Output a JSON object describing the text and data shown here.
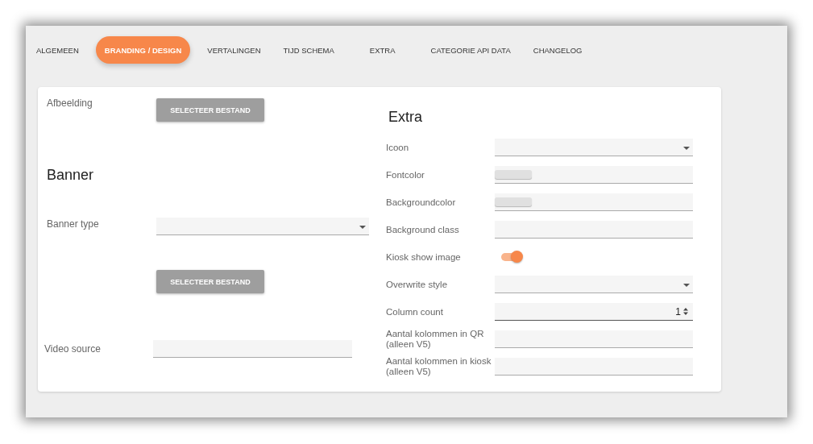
{
  "tabs": [
    {
      "label": "ALGEMEEN",
      "selected": false
    },
    {
      "label": "BRANDING / DESIGN",
      "selected": true
    },
    {
      "label": "VERTALINGEN",
      "selected": false
    },
    {
      "label": "TIJD SCHEMA",
      "selected": false
    },
    {
      "label": "EXTRA",
      "selected": false
    },
    {
      "label": "CATEGORIE API DATA",
      "selected": false
    },
    {
      "label": "CHANGELOG",
      "selected": false
    }
  ],
  "left": {
    "image_label": "Afbeelding",
    "image_button": "SELECTEER BESTAND",
    "banner_heading": "Banner",
    "banner_type_label": "Banner type",
    "banner_button": "SELECTEER BESTAND",
    "video_label": "Video source"
  },
  "extra": {
    "heading": "Extra",
    "fields": [
      {
        "label": "Icoon",
        "kind": "select"
      },
      {
        "label": "Fontcolor",
        "kind": "color"
      },
      {
        "label": "Backgroundcolor",
        "kind": "color"
      },
      {
        "label": "Background class",
        "kind": "text"
      },
      {
        "label": "Kiosk show image",
        "kind": "toggle",
        "on": true
      },
      {
        "label": "Overwrite style",
        "kind": "select"
      },
      {
        "label": "Column count",
        "kind": "number",
        "value": "1"
      },
      {
        "label": "Aantal kolommen in QR (alleen V5)",
        "kind": "text"
      },
      {
        "label": "Aantal kolommen in kiosk (alleen V5)",
        "kind": "text"
      }
    ]
  }
}
